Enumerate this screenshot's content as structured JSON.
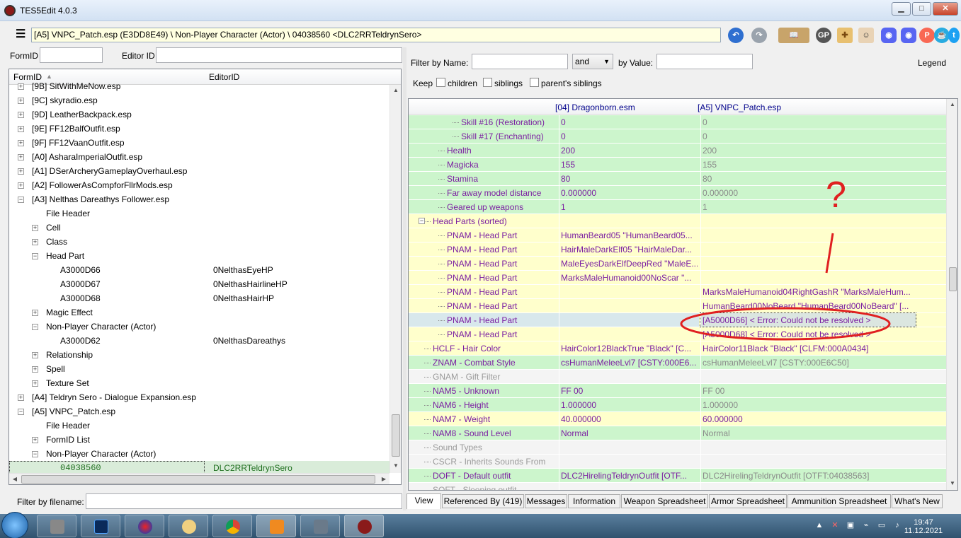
{
  "window": {
    "title": "TES5Edit 4.0.3",
    "min": "▁",
    "max": "□",
    "close": "✕"
  },
  "toolbar": {
    "menu": "☰",
    "path": "[A5] VNPC_Patch.esp (E3DD8E49) \\ Non-Player Character (Actor) \\ 04038560 <DLC2RRTeldrynSero>",
    "icons": [
      "back-icon",
      "forward-icon",
      "book-icon",
      "patreon-gp-icon",
      "puzzle-icon",
      "avatar-icon",
      "discord-icon",
      "discord2-icon",
      "patreon-icon",
      "kofi-icon",
      "twitter-icon"
    ]
  },
  "search": {
    "formid_label": "FormID",
    "editorid_label": "Editor ID",
    "formid_value": "",
    "editorid_value": ""
  },
  "tree": {
    "col_formid": "FormID",
    "col_editorid": "EditorID",
    "rows": [
      {
        "text": "[9B] SitWithMeNow.esp",
        "editor": "",
        "indent": 0,
        "exp": "+"
      },
      {
        "text": "[9C] skyradio.esp",
        "editor": "",
        "indent": 0,
        "exp": "+"
      },
      {
        "text": "[9D] LeatherBackpack.esp",
        "editor": "",
        "indent": 0,
        "exp": "+"
      },
      {
        "text": "[9E] FF12BalfOutfit.esp",
        "editor": "",
        "indent": 0,
        "exp": "+"
      },
      {
        "text": "[9F] FF12VaanOutfit.esp",
        "editor": "",
        "indent": 0,
        "exp": "+"
      },
      {
        "text": "[A0] AsharaImperialOutfit.esp",
        "editor": "",
        "indent": 0,
        "exp": "+"
      },
      {
        "text": "[A1] DSerArcheryGameplayOverhaul.esp",
        "editor": "",
        "indent": 0,
        "exp": "+"
      },
      {
        "text": "[A2] FollowerAsCompforFllrMods.esp",
        "editor": "",
        "indent": 0,
        "exp": "+"
      },
      {
        "text": "[A3] Nelthas Dareathys Follower.esp",
        "editor": "",
        "indent": 0,
        "exp": "−"
      },
      {
        "text": "File Header",
        "editor": "",
        "indent": 1,
        "exp": ""
      },
      {
        "text": "Cell",
        "editor": "",
        "indent": 1,
        "exp": "+"
      },
      {
        "text": "Class",
        "editor": "",
        "indent": 1,
        "exp": "+"
      },
      {
        "text": "Head Part",
        "editor": "",
        "indent": 1,
        "exp": "−"
      },
      {
        "text": "A3000D66",
        "editor": "0NelthasEyeHP",
        "indent": 2,
        "exp": ""
      },
      {
        "text": "A3000D67",
        "editor": "0NelthasHairlineHP",
        "indent": 2,
        "exp": ""
      },
      {
        "text": "A3000D68",
        "editor": "0NelthasHairHP",
        "indent": 2,
        "exp": ""
      },
      {
        "text": "Magic Effect",
        "editor": "",
        "indent": 1,
        "exp": "+"
      },
      {
        "text": "Non-Player Character (Actor)",
        "editor": "",
        "indent": 1,
        "exp": "−"
      },
      {
        "text": "A3000D62",
        "editor": "0NelthasDareathys",
        "indent": 2,
        "exp": ""
      },
      {
        "text": "Relationship",
        "editor": "",
        "indent": 1,
        "exp": "+"
      },
      {
        "text": "Spell",
        "editor": "",
        "indent": 1,
        "exp": "+"
      },
      {
        "text": "Texture Set",
        "editor": "",
        "indent": 1,
        "exp": "+"
      },
      {
        "text": "[A4] Teldryn Sero - Dialogue Expansion.esp",
        "editor": "",
        "indent": 0,
        "exp": "+"
      },
      {
        "text": "[A5] VNPC_Patch.esp",
        "editor": "",
        "indent": 0,
        "exp": "−"
      },
      {
        "text": "File Header",
        "editor": "",
        "indent": 1,
        "exp": ""
      },
      {
        "text": "FormID List",
        "editor": "",
        "indent": 1,
        "exp": "+"
      },
      {
        "text": "Non-Player Character (Actor)",
        "editor": "",
        "indent": 1,
        "exp": "−"
      },
      {
        "text": "04038560",
        "editor": "DLC2RRTeldrynSero",
        "indent": 2,
        "exp": "",
        "selected": true
      }
    ]
  },
  "filter_filename": {
    "label": "Filter by filename:",
    "value": ""
  },
  "filter": {
    "by_name_label": "Filter by Name:",
    "name_value": "",
    "op": "and",
    "by_value_label": "by Value:",
    "value": "",
    "legend": "Legend",
    "keep": "Keep",
    "children": "children",
    "siblings": "siblings",
    "parents_siblings": "parent's siblings"
  },
  "view": {
    "col1": "[04] Dragonborn.esm",
    "col2": "[A5] VNPC_Patch.esp",
    "rows": [
      {
        "name": "Skill #16 (Restoration)",
        "a": "0",
        "b": "0",
        "color": "green",
        "indent": 3,
        "bdim": true
      },
      {
        "name": "Skill #17 (Enchanting)",
        "a": "0",
        "b": "0",
        "color": "green",
        "indent": 3,
        "bdim": true
      },
      {
        "name": "Health",
        "a": "200",
        "b": "200",
        "color": "green",
        "indent": 2,
        "bdim": true
      },
      {
        "name": "Magicka",
        "a": "155",
        "b": "155",
        "color": "green",
        "indent": 2,
        "bdim": true
      },
      {
        "name": "Stamina",
        "a": "80",
        "b": "80",
        "color": "green",
        "indent": 2,
        "bdim": true
      },
      {
        "name": "Far away model distance",
        "a": "0.000000",
        "b": "0.000000",
        "color": "green",
        "indent": 2,
        "bdim": true
      },
      {
        "name": "Geared up weapons",
        "a": "1",
        "b": "1",
        "color": "green",
        "indent": 2,
        "bdim": true
      },
      {
        "name": "Head Parts (sorted)",
        "a": "",
        "b": "",
        "color": "yellow",
        "indent": 1,
        "bdim": false
      },
      {
        "name": "PNAM - Head Part",
        "a": "HumanBeard05 \"HumanBeard05...",
        "b": "",
        "color": "yellow",
        "indent": 2,
        "bdim": false
      },
      {
        "name": "PNAM - Head Part",
        "a": "HairMaleDarkElf05 \"HairMaleDar...",
        "b": "",
        "color": "yellow",
        "indent": 2,
        "bdim": false
      },
      {
        "name": "PNAM - Head Part",
        "a": "MaleEyesDarkElfDeepRed \"MaleE...",
        "b": "",
        "color": "yellow",
        "indent": 2,
        "bdim": false
      },
      {
        "name": "PNAM - Head Part",
        "a": "MarksMaleHumanoid00NoScar \"...",
        "b": "",
        "color": "yellow",
        "indent": 2,
        "bdim": false
      },
      {
        "name": "PNAM - Head Part",
        "a": "",
        "b": "MarksMaleHumanoid04RightGashR \"MarksMaleHum...",
        "color": "yellow",
        "indent": 2,
        "bdim": false
      },
      {
        "name": "PNAM - Head Part",
        "a": "",
        "b": "HumanBeard00NoBeard \"HumanBeard00NoBeard\" [...",
        "color": "yellow",
        "indent": 2,
        "bdim": false
      },
      {
        "name": "PNAM - Head Part",
        "a": "",
        "b": "[A5000D66] < Error: Could not be resolved >",
        "color": "selrow",
        "indent": 2,
        "bdim": false
      },
      {
        "name": "PNAM - Head Part",
        "a": "",
        "b": "[A5000D68] < Error: Could not be resolved >",
        "color": "yellow",
        "indent": 2,
        "bdim": false
      },
      {
        "name": "HCLF - Hair Color",
        "a": "HairColor12BlackTrue \"Black\" [C...",
        "b": "HairColor11Black \"Black\" [CLFM:000A0434]",
        "color": "yellow",
        "indent": 1,
        "bdim": false
      },
      {
        "name": "ZNAM - Combat Style",
        "a": "csHumanMeleeLvl7 [CSTY:000E6...",
        "b": "csHumanMeleeLvl7 [CSTY:000E6C50]",
        "color": "green",
        "indent": 1,
        "bdim": true
      },
      {
        "name": "GNAM - Gift Filter",
        "a": "",
        "b": "",
        "color": "grey",
        "indent": 1,
        "bdim": true
      },
      {
        "name": "NAM5 - Unknown",
        "a": "FF 00",
        "b": "FF 00",
        "color": "green",
        "indent": 1,
        "bdim": true
      },
      {
        "name": "NAM6 - Height",
        "a": "1.000000",
        "b": "1.000000",
        "color": "green",
        "indent": 1,
        "bdim": true
      },
      {
        "name": "NAM7 - Weight",
        "a": "40.000000",
        "b": "60.000000",
        "color": "yellow",
        "indent": 1,
        "bdim": false
      },
      {
        "name": "NAM8 - Sound Level",
        "a": "Normal",
        "b": "Normal",
        "color": "green",
        "indent": 1,
        "bdim": true
      },
      {
        "name": "Sound Types",
        "a": "",
        "b": "",
        "color": "grey",
        "indent": 1,
        "bdim": true
      },
      {
        "name": "CSCR - Inherits Sounds From",
        "a": "",
        "b": "",
        "color": "grey",
        "indent": 1,
        "bdim": true
      },
      {
        "name": "DOFT - Default outfit",
        "a": "DLC2HirelingTeldrynOutfit [OTF...",
        "b": "DLC2HirelingTeldrynOutfit [OTFT:04038563]",
        "color": "green",
        "indent": 1,
        "bdim": true
      },
      {
        "name": "SOFT - Sleeping outfit",
        "a": "",
        "b": "",
        "color": "grey",
        "indent": 1,
        "bdim": true
      }
    ]
  },
  "annotation": {
    "question": "?"
  },
  "tabs": [
    "View",
    "Referenced By (419)",
    "Messages",
    "Information",
    "Weapon Spreadsheet",
    "Armor Spreadsheet",
    "Ammunition Spreadsheet",
    "What's New"
  ],
  "taskbar": {
    "time": "19:47",
    "date": "11.12.2021"
  }
}
